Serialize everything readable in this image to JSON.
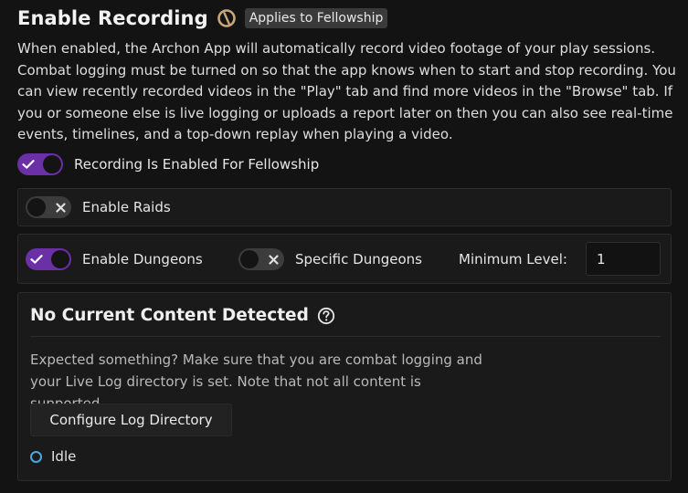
{
  "header": {
    "title": "Enable Recording",
    "badge": "Applies to Fellowship",
    "brand_icon": "archon-logo-icon"
  },
  "description": "When enabled, the Archon App will automatically record video footage of your play sessions. Combat logging must be turned on so that the app knows when to start and stop recording. You can view recently recorded videos in the \"Play\" tab and find more videos in the \"Browse\" tab. If you or someone else is live logging or uploads a report later on then you can also see real-time events, timelines, and a top-down replay when playing a video.",
  "recording_toggle": {
    "label": "Recording Is Enabled For Fellowship",
    "on": true
  },
  "raids": {
    "label": "Enable Raids",
    "on": false
  },
  "dungeons": {
    "enable_label": "Enable Dungeons",
    "enable_on": true,
    "specific_label": "Specific Dungeons",
    "specific_on": false,
    "min_level_label": "Minimum Level:",
    "min_level_value": "1"
  },
  "content": {
    "title": "No Current Content Detected",
    "help_icon": "help-circle-icon",
    "text": "Expected something? Make sure that you are combat logging and your Live Log directory is set. Note that not all content is supported.",
    "button_label": "Configure Log Directory",
    "status": "Idle"
  },
  "colors": {
    "toggle_on": "#6b2fa6",
    "toggle_off": "#3c3c3c",
    "status_idle": "#4aa8e0",
    "background": "#131313"
  }
}
